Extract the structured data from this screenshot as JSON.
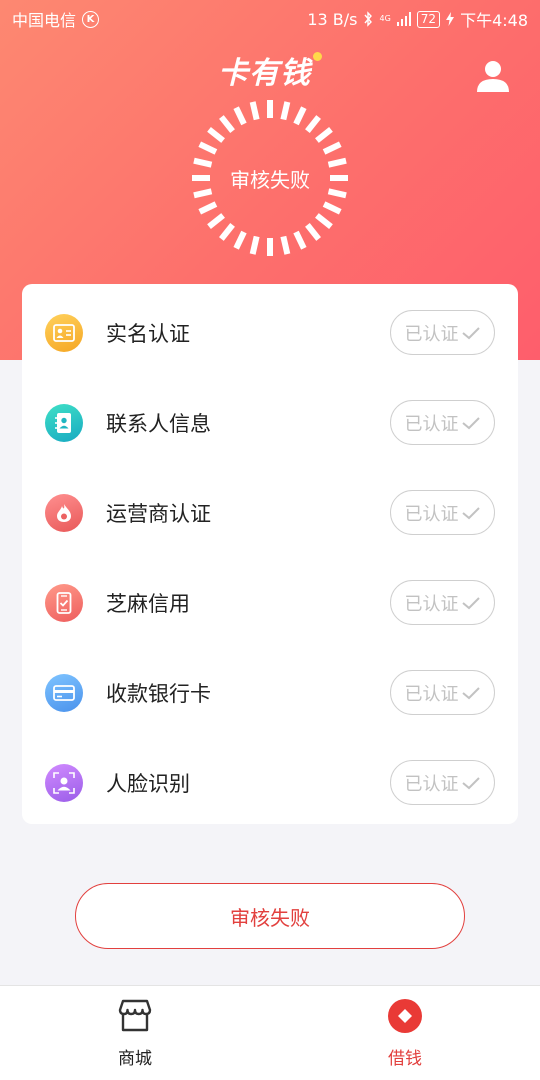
{
  "status_bar": {
    "carrier": "中国电信",
    "carrier_badge": "K",
    "net_speed": "13 B/s",
    "net_type": "4G",
    "battery": "72",
    "time": "下午4:48"
  },
  "header": {
    "brand": "卡有钱"
  },
  "review": {
    "status_text": "审核失败"
  },
  "verify_items": [
    {
      "label": "实名认证",
      "status": "已认证",
      "icon": "id-card-icon",
      "color": "#f7b53a"
    },
    {
      "label": "联系人信息",
      "status": "已认证",
      "icon": "contacts-book-icon",
      "color": "#22c1b0"
    },
    {
      "label": "运营商认证",
      "status": "已认证",
      "icon": "carrier-flame-icon",
      "color": "#f06b6b"
    },
    {
      "label": "芝麻信用",
      "status": "已认证",
      "icon": "credit-phone-icon",
      "color": "#f26a6a"
    },
    {
      "label": "收款银行卡",
      "status": "已认证",
      "icon": "bank-card-icon",
      "color": "#5aa8f5"
    },
    {
      "label": "人脸识别",
      "status": "已认证",
      "icon": "face-scan-icon",
      "color": "#a96bed"
    }
  ],
  "action": {
    "button_label": "审核失败"
  },
  "tabs": [
    {
      "label": "商城",
      "icon": "shop-icon",
      "active": false
    },
    {
      "label": "借钱",
      "icon": "loan-icon",
      "active": true
    }
  ],
  "colors": {
    "accent": "#e2403e",
    "header_gradient_start": "#fd8871",
    "header_gradient_end": "#fe5e6c",
    "muted": "#c2c2c2"
  }
}
